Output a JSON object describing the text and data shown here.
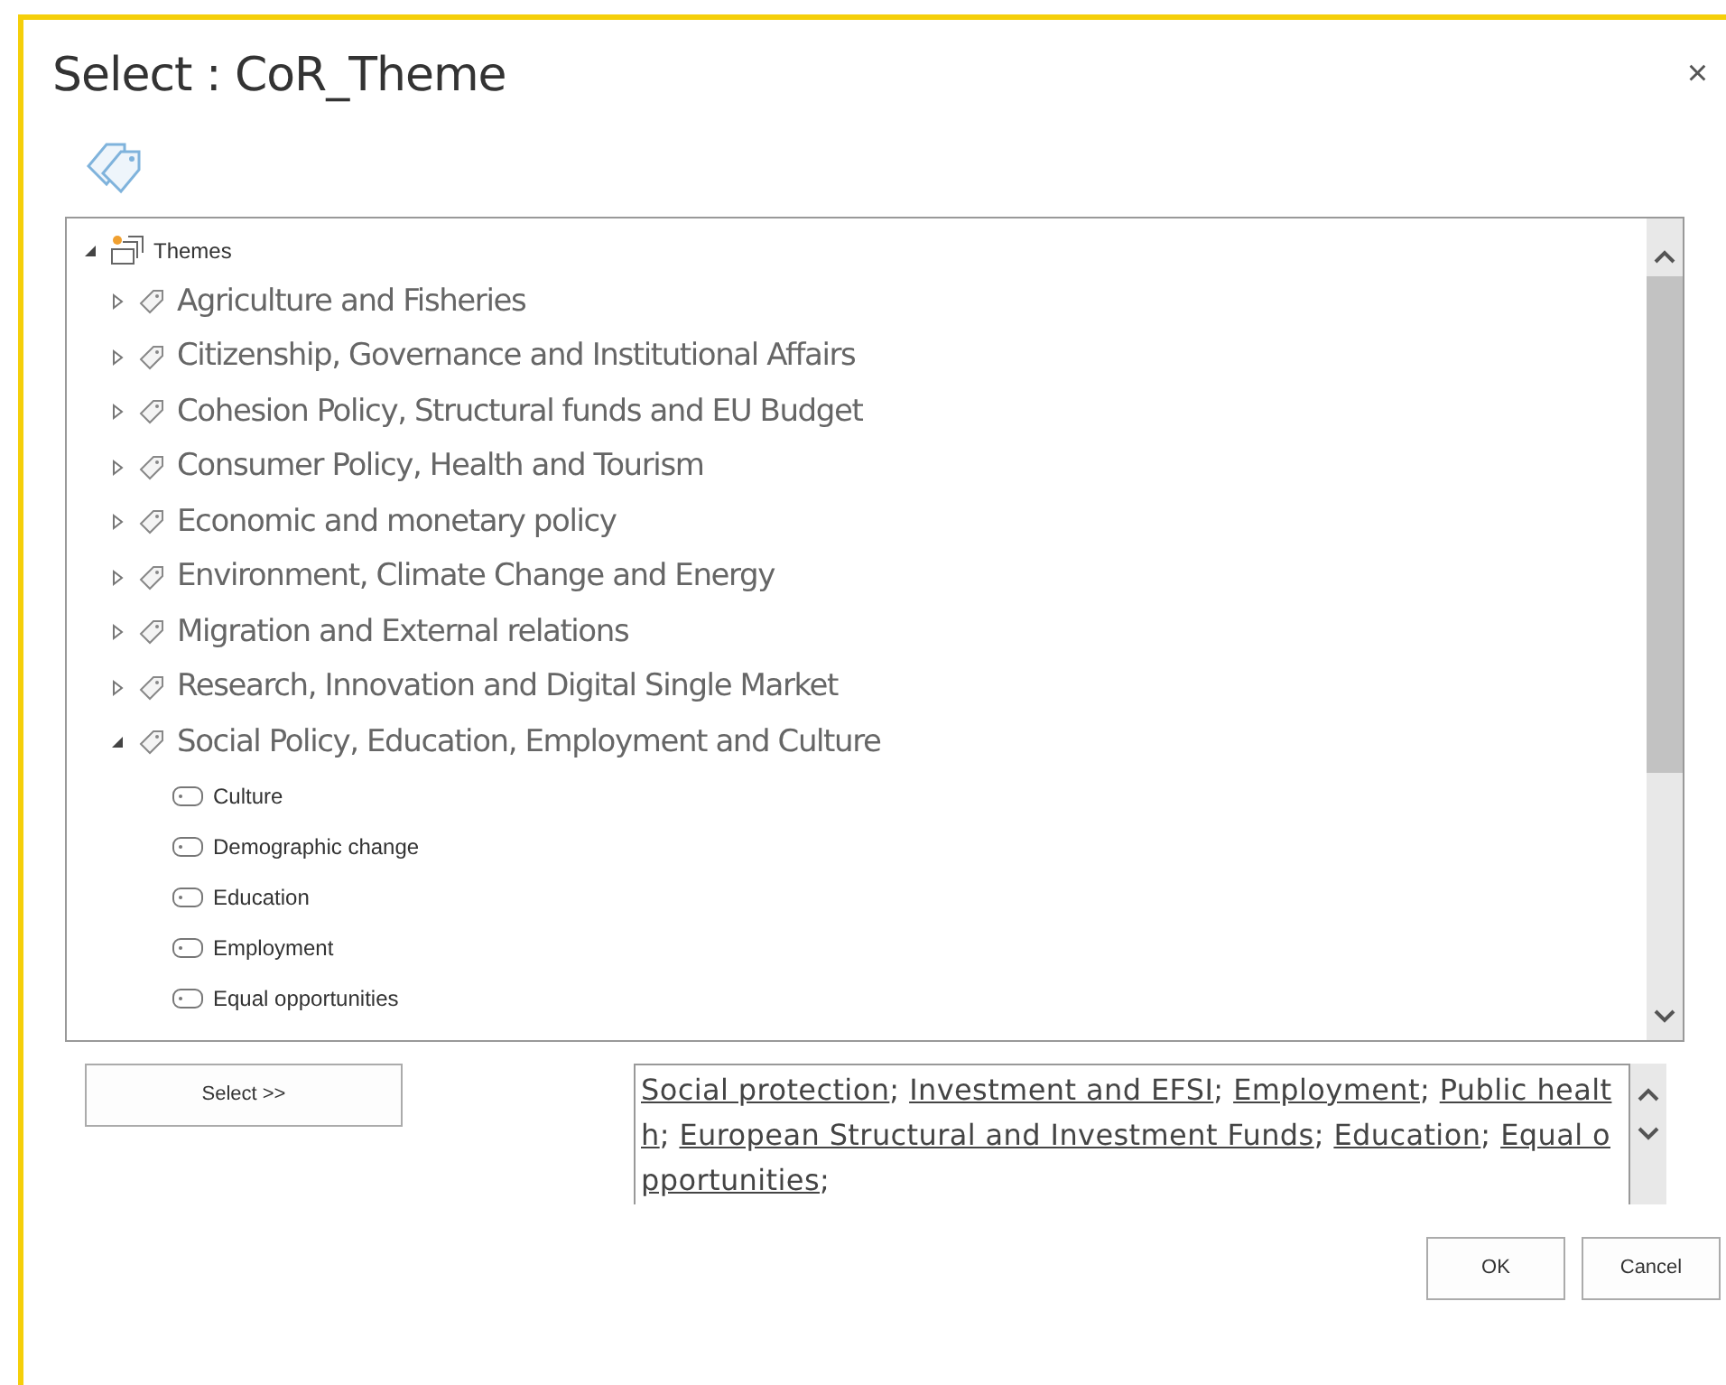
{
  "dialog": {
    "title": "Select : CoR_Theme",
    "close": "×"
  },
  "tree": {
    "label": "Themes",
    "expanded": true,
    "children": [
      {
        "label": "Agriculture and Fisheries",
        "kind": "group",
        "expanded": false
      },
      {
        "label": "Citizenship, Governance and Institutional Affairs",
        "kind": "group",
        "expanded": false
      },
      {
        "label": "Cohesion Policy, Structural funds and EU Budget",
        "kind": "group",
        "expanded": false
      },
      {
        "label": "Consumer Policy, Health and Tourism",
        "kind": "group",
        "expanded": false
      },
      {
        "label": "Economic and monetary policy",
        "kind": "group",
        "expanded": false
      },
      {
        "label": "Environment, Climate Change and Energy",
        "kind": "group",
        "expanded": false
      },
      {
        "label": "Migration and External relations",
        "kind": "group",
        "expanded": false
      },
      {
        "label": "Research, Innovation and Digital Single Market",
        "kind": "group",
        "expanded": false
      },
      {
        "label": "Social Policy, Education, Employment and Culture",
        "kind": "group",
        "expanded": true,
        "children": [
          {
            "label": "Culture",
            "kind": "term"
          },
          {
            "label": "Demographic change",
            "kind": "term"
          },
          {
            "label": "Education",
            "kind": "term"
          },
          {
            "label": "Employment",
            "kind": "term"
          },
          {
            "label": "Equal opportunities",
            "kind": "term"
          }
        ]
      }
    ]
  },
  "select_button": "Select >>",
  "term_separator": ";",
  "selected_terms": [
    "Social protection",
    "Investment and EFSI",
    "Employment",
    "Public health",
    "European Structural and Investment Funds",
    "Education",
    "Equal opportunities"
  ],
  "buttons": [
    "OK",
    "Cancel"
  ]
}
